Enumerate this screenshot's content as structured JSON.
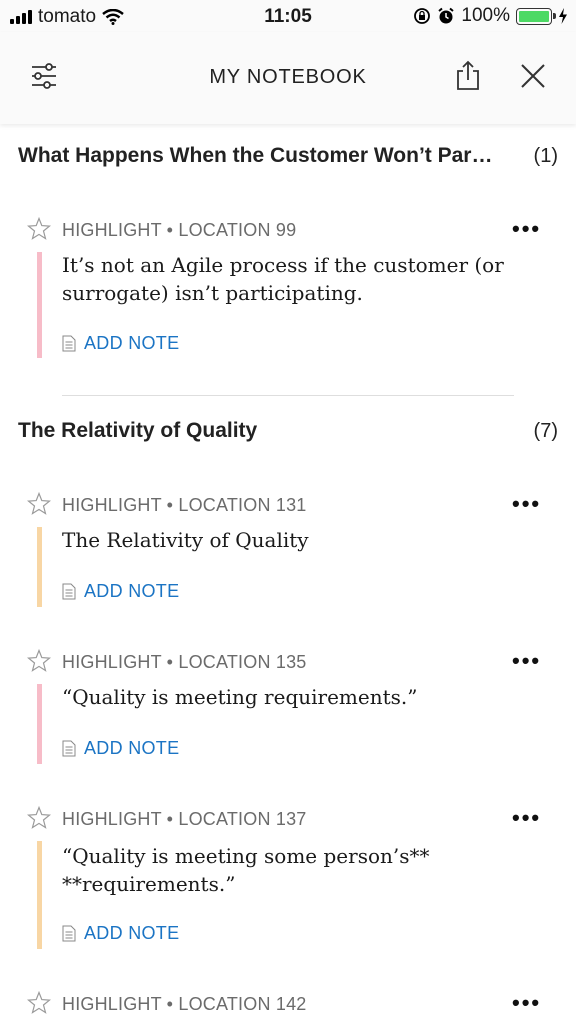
{
  "status": {
    "carrier": "tomato",
    "time": "11:05",
    "battery": "100%"
  },
  "header": {
    "title": "MY NOTEBOOK"
  },
  "sections": [
    {
      "title": "What Happens When the Customer Won’t Par…",
      "count": "(1)",
      "highlights": [
        {
          "meta": "HIGHLIGHT • LOCATION 99",
          "text": "It’s not an Agile process if the customer (or surrogate) isn’t participating.",
          "color": "#f7bcc8",
          "add_note": "ADD NOTE"
        }
      ]
    },
    {
      "title": "The Relativity of Quality",
      "count": "(7)",
      "highlights": [
        {
          "meta": "HIGHLIGHT • LOCATION 131",
          "text": "The Relativity of Quality",
          "color": "#f8d6a4",
          "add_note": "ADD NOTE"
        },
        {
          "meta": "HIGHLIGHT • LOCATION 135",
          "text": "“Quality is meeting requirements.”",
          "color": "#f7bcc8",
          "add_note": "ADD NOTE"
        },
        {
          "meta": "HIGHLIGHT • LOCATION 137",
          "text": "“Quality is meeting some person’s** **requirements.”",
          "color": "#f8d6a4",
          "add_note": "ADD NOTE"
        },
        {
          "meta": "HIGHLIGHT • LOCATION 142"
        }
      ]
    }
  ],
  "icons": {
    "filter": "sliders-icon",
    "share": "share-icon",
    "close": "close-icon",
    "star": "star-outline-icon",
    "more": "more-dots-icon",
    "note": "note-icon"
  }
}
